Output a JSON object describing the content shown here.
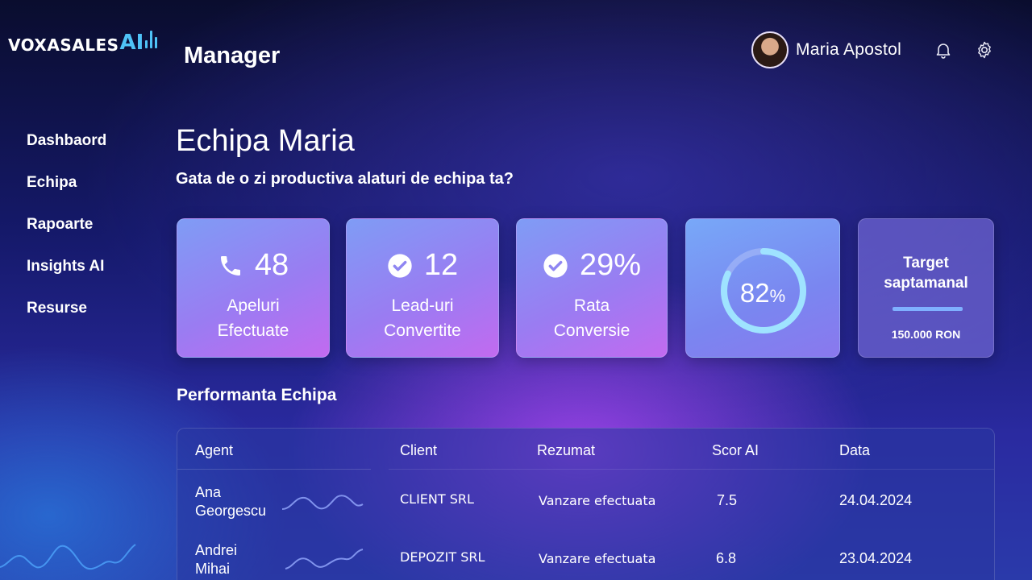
{
  "brand": {
    "name": "VOXASALES",
    "ai": "AI"
  },
  "app_title": "Manager",
  "user": {
    "name": "Maria Apostol"
  },
  "header_icons": [
    "bell-icon",
    "gear-icon"
  ],
  "sidebar": {
    "items": [
      {
        "label": "Dashbaord"
      },
      {
        "label": "Echipa"
      },
      {
        "label": "Rapoarte"
      },
      {
        "label": "Insights AI"
      },
      {
        "label": "Resurse"
      }
    ]
  },
  "page": {
    "title": "Echipa Maria",
    "subtitle": "Gata de o zi productiva alaturi de echipa ta?"
  },
  "stats": [
    {
      "icon": "phone-icon",
      "value": "48",
      "label_line1": "Apeluri",
      "label_line2": "Efectuate"
    },
    {
      "icon": "check-circle-icon",
      "value": "12",
      "label_line1": "Lead-uri",
      "label_line2": "Convertite"
    },
    {
      "icon": "check-circle-icon",
      "value": "29%",
      "label_line1": "Rata",
      "label_line2": "Conversie"
    }
  ],
  "gauge": {
    "value": "82",
    "unit": "%",
    "fraction": 0.82
  },
  "target": {
    "title_line1": "Target",
    "title_line2": "saptamanal",
    "value": "150.000 RON"
  },
  "performance": {
    "title": "Performanta Echipa",
    "columns": [
      "Agent",
      "Client",
      "Rezumat",
      "Scor AI",
      "Data"
    ],
    "rows": [
      {
        "agent_line1": "Ana",
        "agent_line2": "Georgescu",
        "client": "CLIENT SRL",
        "rezumat": "Vanzare efectuata",
        "scor": "7.5",
        "data": "24.04.2024"
      },
      {
        "agent_line1": "Andrei",
        "agent_line2": "Mihai",
        "client": "DEPOZIT SRL",
        "rezumat": "Vanzare efectuata",
        "scor": "6.8",
        "data": "23.04.2024"
      }
    ]
  },
  "colors": {
    "accent": "#4fc3f7",
    "card_gradient_start": "#7f9cf5",
    "card_gradient_end": "#c26af0"
  }
}
